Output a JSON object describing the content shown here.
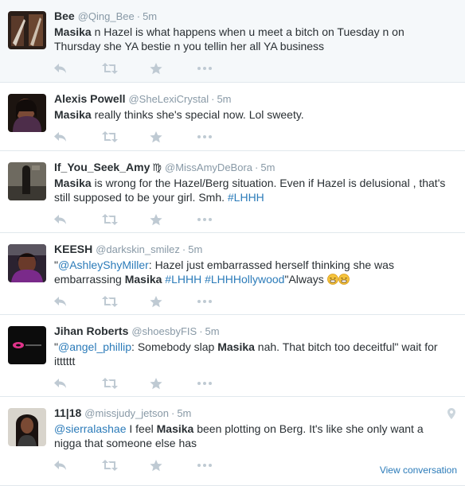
{
  "tweets": [
    {
      "fullname": "Bee",
      "username": "@Qing_Bee",
      "time": "5m",
      "segments": [
        {
          "t": "Masika",
          "s": "b"
        },
        {
          "t": " n Hazel is what happens when u meet a bitch on Tuesday n on Thursday she YA bestie n you tellin her all YA business",
          "s": "n"
        }
      ]
    },
    {
      "fullname": "Alexis Powell",
      "username": "@SheLexiCrystal",
      "time": "5m",
      "segments": [
        {
          "t": "Masika",
          "s": "b"
        },
        {
          "t": " really thinks she's special now. Lol sweety.",
          "s": "n"
        }
      ]
    },
    {
      "fullname": "If_You_Seek_Amy",
      "symbol": "♍",
      "username": "@MissAmyDeBora",
      "time": "5m",
      "segments": [
        {
          "t": "Masika",
          "s": "b"
        },
        {
          "t": " is wrong for the Hazel/Berg situation. Even if Hazel is delusional , that's still supposed to be your girl. Smh. ",
          "s": "n"
        },
        {
          "t": "#LHHH",
          "s": "l"
        }
      ]
    },
    {
      "fullname": "KEESH",
      "username": "@darkskin_smilez",
      "time": "5m",
      "segments": [
        {
          "t": "\"",
          "s": "n"
        },
        {
          "t": "@AshleyShyMiller",
          "s": "l"
        },
        {
          "t": ": Hazel just embarrassed herself thinking she was embarrassing ",
          "s": "n"
        },
        {
          "t": "Masika",
          "s": "b"
        },
        {
          "t": " ",
          "s": "n"
        },
        {
          "t": "#LHHH",
          "s": "l"
        },
        {
          "t": " ",
          "s": "n"
        },
        {
          "t": "#LHHHollywood",
          "s": "l"
        },
        {
          "t": "\"Always ",
          "s": "n"
        },
        {
          "t": "",
          "s": "e"
        },
        {
          "t": "",
          "s": "e"
        }
      ]
    },
    {
      "fullname": "Jihan Roberts",
      "username": "@shoesbyFIS",
      "time": "5m",
      "segments": [
        {
          "t": "\"",
          "s": "n"
        },
        {
          "t": "@angel_phillip",
          "s": "l"
        },
        {
          "t": ": Somebody slap ",
          "s": "n"
        },
        {
          "t": "Masika",
          "s": "b"
        },
        {
          "t": " nah. That bitch too deceitful\" wait for itttttt",
          "s": "n"
        }
      ]
    },
    {
      "fullname": "11|18",
      "username": "@missjudy_jetson",
      "time": "5m",
      "segments": [
        {
          "t": "@sierralashae",
          "s": "l"
        },
        {
          "t": " I feel ",
          "s": "n"
        },
        {
          "t": "Masika",
          "s": "b"
        },
        {
          "t": " been plotting on Berg. It's like she only want a nigga that someone else has",
          "s": "n"
        }
      ],
      "view_conversation": "View conversation"
    }
  ],
  "icons": {
    "actions": [
      "reply-icon",
      "retweet-icon",
      "favorite-icon",
      "more-icon"
    ],
    "geo": "location-pin-icon"
  },
  "colors": {
    "link": "#2b7bb9",
    "muted": "#8899a6",
    "icon": "#bfcad3",
    "highlight": "#f5f8fa",
    "divider": "#e1e8ed"
  }
}
